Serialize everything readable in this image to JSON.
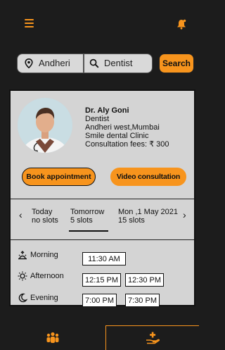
{
  "header": {
    "menu_icon": "hamburger-icon",
    "notification_icon": "bell-icon",
    "accent": "#f7941d"
  },
  "search": {
    "location_value": "Andheri",
    "query_value": "Dentist",
    "button_label": "Search"
  },
  "doctor": {
    "name": "Dr. Aly Goni",
    "specialty": "Dentist",
    "location": "Andheri west,Mumbai",
    "clinic": "Smile dental Clinic",
    "fees": "Consultation fees: ₹ 300",
    "book_label": "Book appointment",
    "video_label": "Video consultation"
  },
  "days": [
    {
      "label": "Today",
      "slots": "no slots"
    },
    {
      "label": "Tomorrow",
      "slots": "5 slots"
    },
    {
      "label": "Mon ,1 May 2021",
      "slots": "15 slots"
    }
  ],
  "sessions": {
    "morning": {
      "label": "Morning",
      "times": [
        "11:30 AM"
      ]
    },
    "afternoon": {
      "label": "Afternoon",
      "times": [
        "12:15 PM",
        "12:30 PM"
      ]
    },
    "evening": {
      "label": "Evening",
      "times": [
        "7:00 PM",
        "7:30 PM"
      ]
    }
  },
  "bottom_nav": {
    "left_icon": "people-group-icon",
    "right_icon": "hand-plus-icon"
  }
}
